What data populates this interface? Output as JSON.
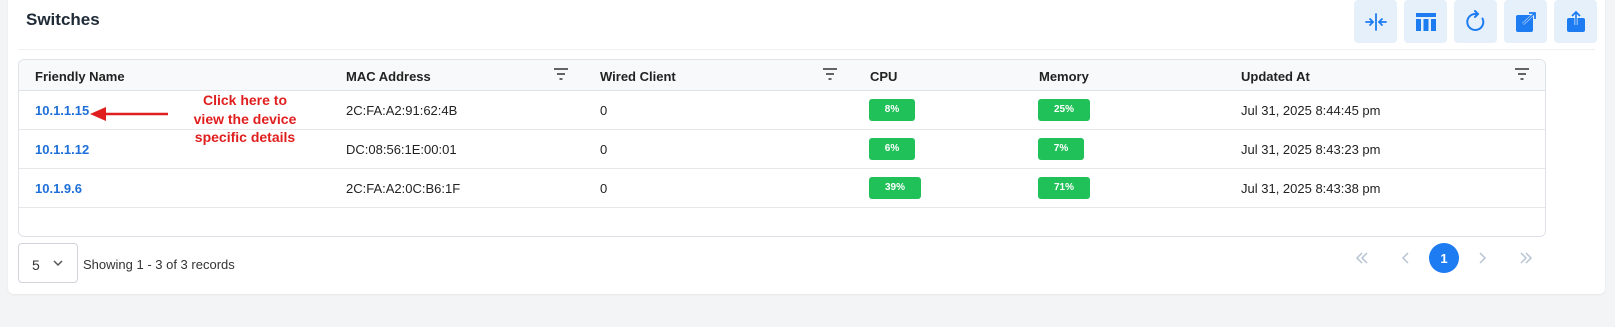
{
  "header": {
    "title": "Switches"
  },
  "toolbar": {
    "buttons": [
      {
        "name": "collapse-icon"
      },
      {
        "name": "columns-icon"
      },
      {
        "name": "refresh-icon"
      },
      {
        "name": "open-external-icon"
      },
      {
        "name": "export-icon"
      }
    ],
    "accent_bg": "#e6f0fb",
    "accent_fg": "#1e7cf2"
  },
  "table": {
    "columns": [
      "Friendly Name",
      "MAC Address",
      "Wired Client",
      "CPU",
      "Memory",
      "Updated At"
    ],
    "rows": [
      {
        "name": "10.1.1.15",
        "mac": "2C:FA:A2:91:62:4B",
        "wired": "0",
        "cpu": "8%",
        "memory": "25%",
        "updated": "Jul 31, 2025 8:44:45 pm"
      },
      {
        "name": "10.1.1.12",
        "mac": "DC:08:56:1E:00:01",
        "wired": "0",
        "cpu": "6%",
        "memory": "7%",
        "updated": "Jul 31, 2025 8:43:23 pm"
      },
      {
        "name": "10.1.9.6",
        "mac": "2C:FA:A2:0C:B6:1F",
        "wired": "0",
        "cpu": "39%",
        "memory": "71%",
        "updated": "Jul 31, 2025 8:43:38 pm"
      }
    ],
    "badge_color": "#21c15a",
    "link_color": "#1e6fd9"
  },
  "annotation": {
    "lines": [
      "Click here to",
      "view the device",
      "specific details"
    ],
    "color": "#e01e1e"
  },
  "footer": {
    "page_size": "5",
    "records_text": "Showing 1 - 3 of 3 records",
    "current_page": "1"
  }
}
